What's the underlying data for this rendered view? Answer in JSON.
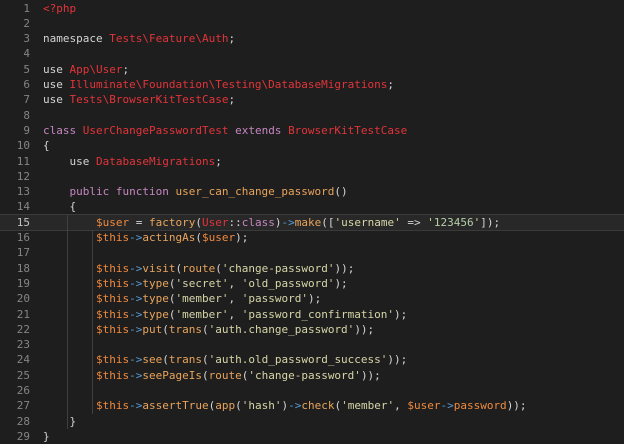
{
  "editor": {
    "current_line": 15,
    "lines": [
      {
        "n": "1",
        "t": [
          {
            "c": "tag",
            "s": "<?php"
          }
        ]
      },
      {
        "n": "2",
        "t": []
      },
      {
        "n": "3",
        "t": [
          {
            "c": "plain",
            "s": "namespace "
          },
          {
            "c": "ns",
            "s": "Tests\\Feature\\Auth"
          },
          {
            "c": "plain",
            "s": ";"
          }
        ]
      },
      {
        "n": "4",
        "t": []
      },
      {
        "n": "5",
        "t": [
          {
            "c": "plain",
            "s": "use "
          },
          {
            "c": "ns",
            "s": "App\\User"
          },
          {
            "c": "plain",
            "s": ";"
          }
        ]
      },
      {
        "n": "6",
        "t": [
          {
            "c": "plain",
            "s": "use "
          },
          {
            "c": "ns",
            "s": "Illuminate\\Foundation\\Testing\\DatabaseMigrations"
          },
          {
            "c": "plain",
            "s": ";"
          }
        ]
      },
      {
        "n": "7",
        "t": [
          {
            "c": "plain",
            "s": "use "
          },
          {
            "c": "ns",
            "s": "Tests\\BrowserKitTestCase"
          },
          {
            "c": "plain",
            "s": ";"
          }
        ]
      },
      {
        "n": "8",
        "t": []
      },
      {
        "n": "9",
        "t": [
          {
            "c": "kw",
            "s": "class "
          },
          {
            "c": "cls",
            "s": "UserChangePasswordTest"
          },
          {
            "c": "kw",
            "s": " extends "
          },
          {
            "c": "cls",
            "s": "BrowserKitTestCase"
          }
        ]
      },
      {
        "n": "10",
        "t": [
          {
            "c": "plain",
            "s": "{"
          }
        ]
      },
      {
        "n": "11",
        "t": [
          {
            "c": "plain",
            "s": "    use "
          },
          {
            "c": "cls",
            "s": "DatabaseMigrations"
          },
          {
            "c": "plain",
            "s": ";"
          }
        ]
      },
      {
        "n": "12",
        "t": []
      },
      {
        "n": "13",
        "t": [
          {
            "c": "plain",
            "s": "    "
          },
          {
            "c": "kw",
            "s": "public function "
          },
          {
            "c": "fn",
            "s": "user_can_change_password"
          },
          {
            "c": "plain",
            "s": "()"
          }
        ]
      },
      {
        "n": "14",
        "t": [
          {
            "c": "plain",
            "s": "    {"
          }
        ]
      },
      {
        "n": "15",
        "t": [
          {
            "c": "plain",
            "s": "        "
          },
          {
            "c": "var",
            "s": "$user"
          },
          {
            "c": "plain",
            "s": " = "
          },
          {
            "c": "fn",
            "s": "factory"
          },
          {
            "c": "plain",
            "s": "("
          },
          {
            "c": "cls",
            "s": "User"
          },
          {
            "c": "plain",
            "s": "::"
          },
          {
            "c": "kw",
            "s": "class"
          },
          {
            "c": "plain",
            "s": ")"
          },
          {
            "c": "arrow",
            "s": "->"
          },
          {
            "c": "fn",
            "s": "make"
          },
          {
            "c": "plain",
            "s": "("
          },
          {
            "c": "plain",
            "s": "["
          },
          {
            "c": "str",
            "s": "'username'"
          },
          {
            "c": "plain",
            "s": " => "
          },
          {
            "c": "str",
            "s": "'"
          },
          {
            "c": "num",
            "s": "123456"
          },
          {
            "c": "str",
            "s": "'"
          },
          {
            "c": "plain",
            "s": "]"
          },
          {
            "c": "plain",
            "s": ");"
          }
        ]
      },
      {
        "n": "16",
        "t": [
          {
            "c": "plain",
            "s": "        "
          },
          {
            "c": "var",
            "s": "$this"
          },
          {
            "c": "arrow",
            "s": "->"
          },
          {
            "c": "fn",
            "s": "actingAs"
          },
          {
            "c": "plain",
            "s": "("
          },
          {
            "c": "var",
            "s": "$user"
          },
          {
            "c": "plain",
            "s": ");"
          }
        ]
      },
      {
        "n": "17",
        "t": []
      },
      {
        "n": "18",
        "t": [
          {
            "c": "plain",
            "s": "        "
          },
          {
            "c": "var",
            "s": "$this"
          },
          {
            "c": "arrow",
            "s": "->"
          },
          {
            "c": "fn",
            "s": "visit"
          },
          {
            "c": "plain",
            "s": "("
          },
          {
            "c": "fn",
            "s": "route"
          },
          {
            "c": "plain",
            "s": "("
          },
          {
            "c": "str",
            "s": "'change-password'"
          },
          {
            "c": "plain",
            "s": "));"
          }
        ]
      },
      {
        "n": "19",
        "t": [
          {
            "c": "plain",
            "s": "        "
          },
          {
            "c": "var",
            "s": "$this"
          },
          {
            "c": "arrow",
            "s": "->"
          },
          {
            "c": "fn",
            "s": "type"
          },
          {
            "c": "plain",
            "s": "("
          },
          {
            "c": "str",
            "s": "'secret'"
          },
          {
            "c": "plain",
            "s": ", "
          },
          {
            "c": "str",
            "s": "'old_password'"
          },
          {
            "c": "plain",
            "s": ");"
          }
        ]
      },
      {
        "n": "20",
        "t": [
          {
            "c": "plain",
            "s": "        "
          },
          {
            "c": "var",
            "s": "$this"
          },
          {
            "c": "arrow",
            "s": "->"
          },
          {
            "c": "fn",
            "s": "type"
          },
          {
            "c": "plain",
            "s": "("
          },
          {
            "c": "str",
            "s": "'member'"
          },
          {
            "c": "plain",
            "s": ", "
          },
          {
            "c": "str",
            "s": "'password'"
          },
          {
            "c": "plain",
            "s": ");"
          }
        ]
      },
      {
        "n": "21",
        "t": [
          {
            "c": "plain",
            "s": "        "
          },
          {
            "c": "var",
            "s": "$this"
          },
          {
            "c": "arrow",
            "s": "->"
          },
          {
            "c": "fn",
            "s": "type"
          },
          {
            "c": "plain",
            "s": "("
          },
          {
            "c": "str",
            "s": "'member'"
          },
          {
            "c": "plain",
            "s": ", "
          },
          {
            "c": "str",
            "s": "'password_confirmation'"
          },
          {
            "c": "plain",
            "s": ");"
          }
        ]
      },
      {
        "n": "22",
        "t": [
          {
            "c": "plain",
            "s": "        "
          },
          {
            "c": "var",
            "s": "$this"
          },
          {
            "c": "arrow",
            "s": "->"
          },
          {
            "c": "fn",
            "s": "put"
          },
          {
            "c": "plain",
            "s": "("
          },
          {
            "c": "fn",
            "s": "trans"
          },
          {
            "c": "plain",
            "s": "("
          },
          {
            "c": "str",
            "s": "'auth.change_password'"
          },
          {
            "c": "plain",
            "s": "));"
          }
        ]
      },
      {
        "n": "23",
        "t": []
      },
      {
        "n": "24",
        "t": [
          {
            "c": "plain",
            "s": "        "
          },
          {
            "c": "var",
            "s": "$this"
          },
          {
            "c": "arrow",
            "s": "->"
          },
          {
            "c": "fn",
            "s": "see"
          },
          {
            "c": "plain",
            "s": "("
          },
          {
            "c": "fn",
            "s": "trans"
          },
          {
            "c": "plain",
            "s": "("
          },
          {
            "c": "str",
            "s": "'auth.old_password_success'"
          },
          {
            "c": "plain",
            "s": "));"
          }
        ]
      },
      {
        "n": "25",
        "t": [
          {
            "c": "plain",
            "s": "        "
          },
          {
            "c": "var",
            "s": "$this"
          },
          {
            "c": "arrow",
            "s": "->"
          },
          {
            "c": "fn",
            "s": "seePageIs"
          },
          {
            "c": "plain",
            "s": "("
          },
          {
            "c": "fn",
            "s": "route"
          },
          {
            "c": "plain",
            "s": "("
          },
          {
            "c": "str",
            "s": "'change-password'"
          },
          {
            "c": "plain",
            "s": "));"
          }
        ]
      },
      {
        "n": "26",
        "t": []
      },
      {
        "n": "27",
        "t": [
          {
            "c": "plain",
            "s": "        "
          },
          {
            "c": "var",
            "s": "$this"
          },
          {
            "c": "arrow",
            "s": "->"
          },
          {
            "c": "fn",
            "s": "assertTrue"
          },
          {
            "c": "plain",
            "s": "("
          },
          {
            "c": "fn",
            "s": "app"
          },
          {
            "c": "plain",
            "s": "("
          },
          {
            "c": "str",
            "s": "'hash'"
          },
          {
            "c": "plain",
            "s": ")"
          },
          {
            "c": "arrow",
            "s": "->"
          },
          {
            "c": "fn",
            "s": "check"
          },
          {
            "c": "plain",
            "s": "("
          },
          {
            "c": "str",
            "s": "'member'"
          },
          {
            "c": "plain",
            "s": ", "
          },
          {
            "c": "var",
            "s": "$user"
          },
          {
            "c": "arrow",
            "s": "->"
          },
          {
            "c": "var",
            "s": "password"
          },
          {
            "c": "plain",
            "s": "));"
          }
        ]
      },
      {
        "n": "28",
        "t": [
          {
            "c": "plain",
            "s": "    }"
          }
        ]
      },
      {
        "n": "29",
        "t": [
          {
            "c": "plain",
            "s": "}"
          }
        ]
      }
    ]
  },
  "colors": {
    "background": "#1e1e1e",
    "keyword": "#c586c0",
    "class_name": "#e2343a",
    "variable": "#f08a3e",
    "function": "#e9a45c",
    "string": "#d6d6a8"
  }
}
